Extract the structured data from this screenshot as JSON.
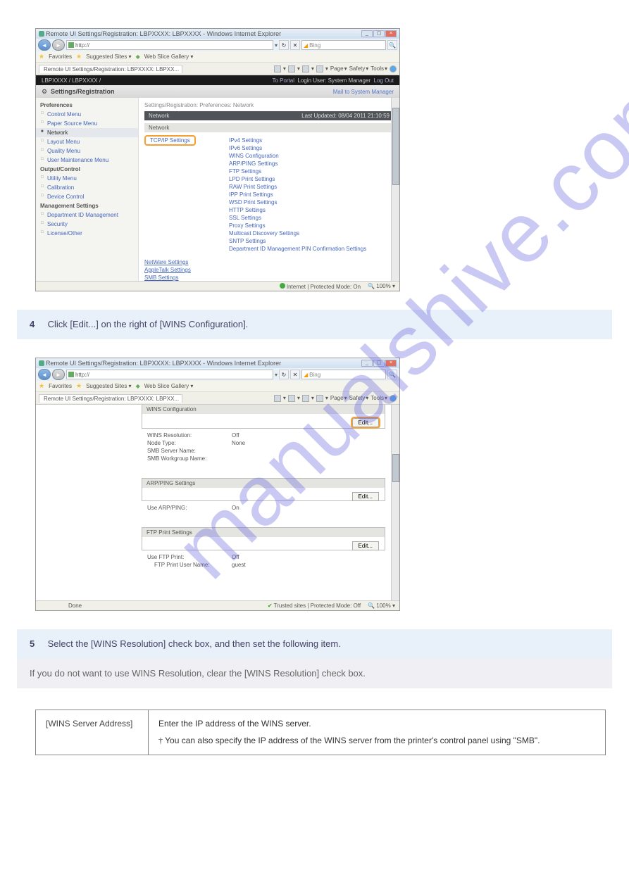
{
  "watermark": "manualshive.com",
  "shot1": {
    "title": "Remote UI Settings/Registration: LBPXXXX: LBPXXXX - Windows Internet Explorer",
    "url": "http://",
    "search_engine": "Bing",
    "favbar_favorites": "Favorites",
    "favbar_suggested": "Suggested Sites",
    "favbar_webslice": "Web Slice Gallery",
    "tab": "Remote UI Settings/Registration: LBPXXXX: LBPXX...",
    "tb_page": "Page",
    "tb_safety": "Safety",
    "tb_tools": "Tools",
    "blackbar_left": "LBPXXXX / LBPXXXX /",
    "blackbar_right_portal": "To Portal",
    "blackbar_right_login": "Login User: System Manager",
    "blackbar_right_logout": "Log Out",
    "greybar_title": "Settings/Registration",
    "greybar_mail": "Mail to System Manager",
    "sidebar": {
      "preferences": "Preferences",
      "control_menu": "Control Menu",
      "paper_source": "Paper Source Menu",
      "network": "Network",
      "layout": "Layout Menu",
      "quality": "Quality Menu",
      "user_maint": "User Maintenance Menu",
      "output": "Output/Control",
      "utility": "Utility Menu",
      "calibration": "Calibration",
      "device_control": "Device Control",
      "mgmt": "Management Settings",
      "dept_id": "Department ID Management",
      "security": "Security",
      "license": "License/Other"
    },
    "breadcrumb": "Settings/Registration: Preferences: Network",
    "band_network": "Network",
    "band_updated": "Last Updated: 08/04 2011 21:10:59",
    "band_network2": "Network",
    "tcpip": "TCP/IP Settings",
    "links": [
      "IPv4 Settings",
      "IPv6 Settings",
      "WINS Configuration",
      "ARP/PING Settings",
      "FTP Settings",
      "LPD Print Settings",
      "RAW Print Settings",
      "IPP Print Settings",
      "WSD Print Settings",
      "HTTP Settings",
      "SSL Settings",
      "Proxy Settings",
      "Multicast Discovery Settings",
      "SNTP Settings",
      "Department ID Management PIN Confirmation Settings"
    ],
    "bottom_links": [
      "NetWare Settings",
      "AppleTalk Settings",
      "SMB Settings"
    ],
    "status_mode": "Internet | Protected Mode: On",
    "status_zoom": "100%"
  },
  "instr1": {
    "num": "4",
    "text": "Click [Edit...] on the right of [WINS Configuration]."
  },
  "shot2": {
    "title": "Remote UI Settings/Registration: LBPXXXX: LBPXXXX - Windows Internet Explorer",
    "url": "http://",
    "search_engine": "Bing",
    "tab": "Remote UI Settings/Registration: LBPXXXX: LBPXX...",
    "panel1_title": "WINS Configuration",
    "edit": "Edit...",
    "wins_res": {
      "k": "WINS Resolution:",
      "v": "Off"
    },
    "node_type": {
      "k": "Node Type:",
      "v": "None"
    },
    "smb_server": {
      "k": "SMB Server Name:",
      "v": ""
    },
    "smb_wg": {
      "k": "SMB Workgroup Name:",
      "v": ""
    },
    "panel2_title": "ARP/PING Settings",
    "arpping": {
      "k": "Use ARP/PING:",
      "v": "On"
    },
    "panel3_title": "FTP Print Settings",
    "use_ftp": {
      "k": "Use FTP Print:",
      "v": "Off"
    },
    "ftp_user": {
      "k": "FTP Print User Name:",
      "v": "guest"
    },
    "status_done": "Done",
    "status_mode": "Trusted sites | Protected Mode: Off",
    "status_zoom": "100%"
  },
  "instr2": {
    "num": "5",
    "text": "Select the [WINS Resolution] check box, and then set the following item."
  },
  "note": "If you do not want to use WINS Resolution, clear the [WINS Resolution] check box.",
  "table": {
    "left": "[WINS Server Address]",
    "right_line1": "Enter the IP address of the WINS server.",
    "right_line2": " You can also specify the IP address of the WINS server from the printer's control panel using \"SMB\"."
  }
}
